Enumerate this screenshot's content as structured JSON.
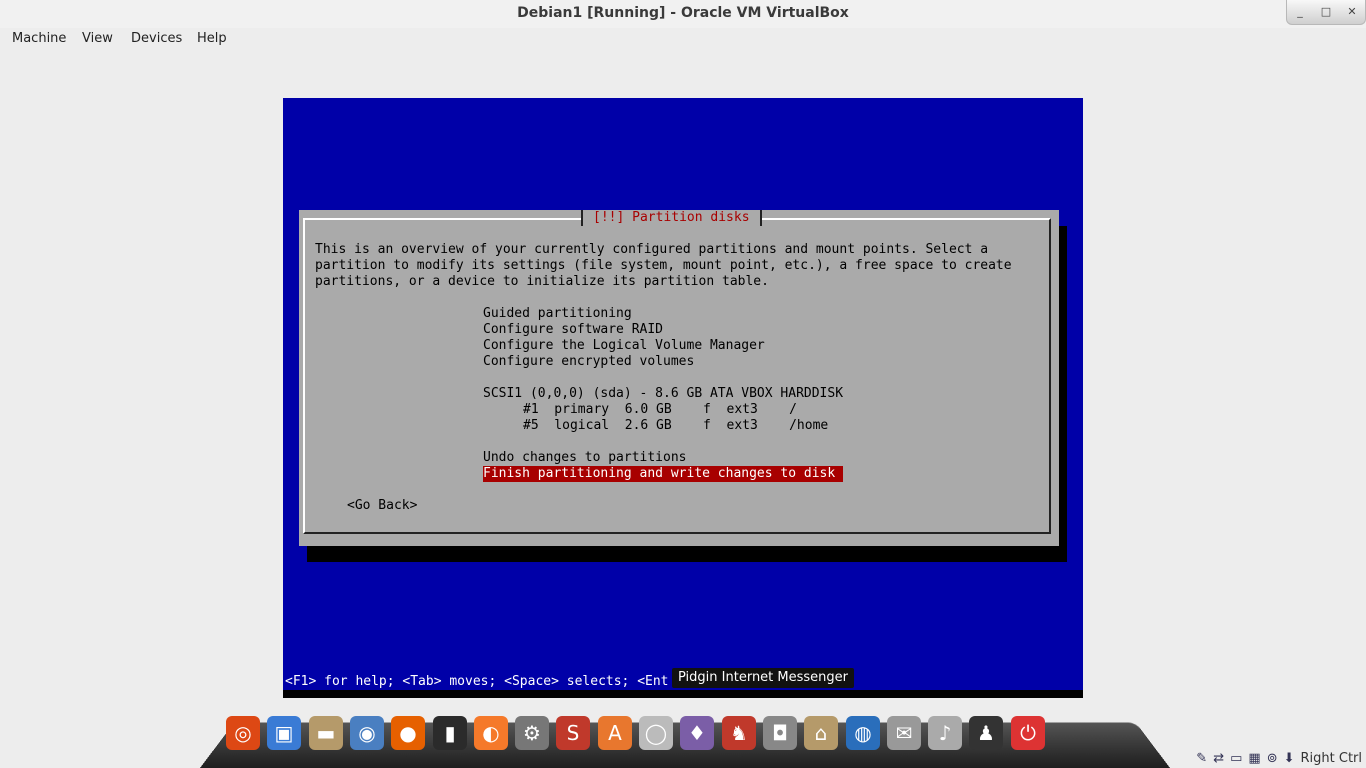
{
  "window": {
    "title": "Debian1 [Running] - Oracle VM VirtualBox"
  },
  "menu": [
    "Machine",
    "View",
    "Devices",
    "Help"
  ],
  "installer": {
    "dialog_title": "[!!] Partition disks",
    "intro": [
      "This is an overview of your currently configured partitions and mount points. Select a",
      "partition to modify its settings (file system, mount point, etc.), a free space to create",
      "partitions, or a device to initialize its partition table."
    ],
    "options": [
      "Guided partitioning",
      "Configure software RAID",
      "Configure the Logical Volume Manager",
      "Configure encrypted volumes"
    ],
    "disk": "SCSI1 (0,0,0) (sda) - 8.6 GB ATA VBOX HARDDISK",
    "partitions": [
      "#1  primary  6.0 GB    f  ext3    /",
      "#5  logical  2.6 GB    f  ext3    /home"
    ],
    "undo": "Undo changes to partitions",
    "finish": "Finish partitioning and write changes to disk",
    "go_back": "<Go Back>",
    "help": "<F1> for help; <Tab> moves; <Space> selects; <Ent"
  },
  "tooltip": "Pidgin Internet Messenger",
  "tray": {
    "host_key": "Right Ctrl"
  },
  "dock": {
    "icons": [
      {
        "name": "ubuntu-icon",
        "glyph": "◎",
        "color": "#dd4814"
      },
      {
        "name": "system-monitor-icon",
        "glyph": "▣",
        "color": "#3a7bd5"
      },
      {
        "name": "folder-icon",
        "glyph": "▬",
        "color": "#b59a6a"
      },
      {
        "name": "chromium-icon",
        "glyph": "◉",
        "color": "#4a7fc1"
      },
      {
        "name": "firefox-icon",
        "glyph": "●",
        "color": "#e66000"
      },
      {
        "name": "terminal-icon",
        "glyph": "▮",
        "color": "#2b2b2b"
      },
      {
        "name": "blender-icon",
        "glyph": "◐",
        "color": "#f5792a"
      },
      {
        "name": "settings-icon",
        "glyph": "⚙",
        "color": "#777"
      },
      {
        "name": "ssr-icon",
        "glyph": "S",
        "color": "#c0392b"
      },
      {
        "name": "software-center-icon",
        "glyph": "A",
        "color": "#e8772e"
      },
      {
        "name": "disc-icon",
        "glyph": "◯",
        "color": "#bbb"
      },
      {
        "name": "pidgin-icon",
        "glyph": "♦",
        "color": "#7b5ea7"
      },
      {
        "name": "supertux-icon",
        "glyph": "♞",
        "color": "#c0392b"
      },
      {
        "name": "camera-icon",
        "glyph": "◘",
        "color": "#888"
      },
      {
        "name": "home-folder-icon",
        "glyph": "⌂",
        "color": "#b59a6a"
      },
      {
        "name": "thunderbird-icon",
        "glyph": "◍",
        "color": "#2a6ebb"
      },
      {
        "name": "mail-icon",
        "glyph": "✉",
        "color": "#999"
      },
      {
        "name": "volume-icon",
        "glyph": "♪",
        "color": "#aaa"
      },
      {
        "name": "tux-icon",
        "glyph": "♟",
        "color": "#333"
      },
      {
        "name": "shutdown-icon",
        "glyph": "⏻",
        "color": "#d33"
      }
    ]
  }
}
